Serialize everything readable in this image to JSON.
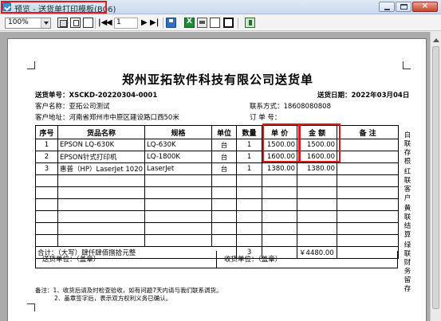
{
  "window": {
    "title": "预览 - 送货单打印模板(B06)"
  },
  "toolbar": {
    "zoom_value": "100%",
    "page_number": "1",
    "nav_first": "|◀",
    "nav_prev": "◀",
    "nav_next": "▶",
    "nav_last": "▶|"
  },
  "document": {
    "company_title": "郑州亚拓软件科技有限公司送货单",
    "order_no_label": "送货单号：",
    "order_no": "XSCKD-20220304-0001",
    "delivery_date_label": "送货日期：",
    "delivery_date": "2022年03月04日",
    "customer_name_label": "客户名称：",
    "customer_name": "亚拓公司测试",
    "contact_label": "联系方式：",
    "contact": "18608080808",
    "address_label": "客户地址：",
    "address": "河南省郑州市中原区建设路口西50米",
    "order_label": "订 单 号：",
    "order_value": "",
    "columns": [
      "序号",
      "货品名称",
      "规格",
      "单位",
      "数量",
      "单 价",
      "金 额",
      "备 注"
    ],
    "rows": [
      {
        "no": "1",
        "name": "EPSON LQ-630K",
        "spec": "LQ-630K",
        "unit": "台",
        "qty": "1",
        "price": "1500.00",
        "amount": "1500.00",
        "remark": ""
      },
      {
        "no": "2",
        "name": "EPSON针式打印机",
        "spec": "LQ-1800K",
        "unit": "台",
        "qty": "1",
        "price": "1600.00",
        "amount": "1600.00",
        "remark": ""
      },
      {
        "no": "3",
        "name": "惠普（HP）LaserJet 1020",
        "spec": "LaserJet",
        "unit": "台",
        "qty": "1",
        "price": "1380.00",
        "amount": "1380.00",
        "remark": ""
      }
    ],
    "total_label": "合计：",
    "total_words": "（大写）肆仟肆佰捌拾元整",
    "total_qty": "3",
    "total_amount": "￥4480.00",
    "sender_label": "送货单位：（盖章）",
    "receiver_label": "收货单位：（盖章）",
    "note_1": "备注：1、收货后请及时检查验收，如有问题7天内请与我们联系调货。",
    "note_2": "2、盖章签字后，表示双方权利义务已确认。",
    "side_labels": [
      "白联存根",
      "红联客户",
      "黄联结算",
      "绿联财务留存"
    ]
  }
}
